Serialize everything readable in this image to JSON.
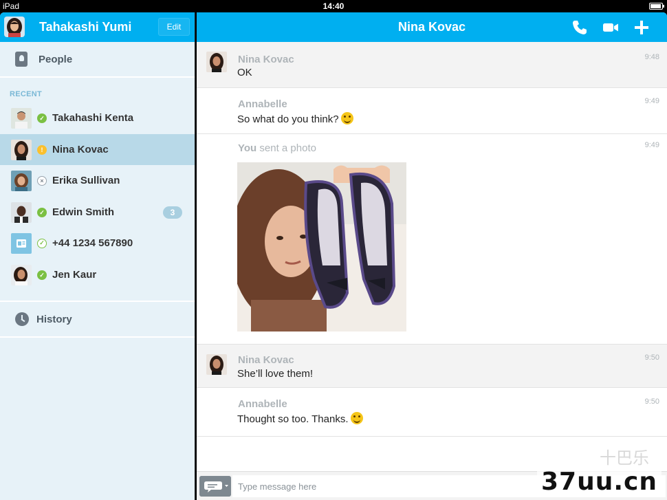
{
  "status_bar": {
    "device": "iPad",
    "time": "14:40"
  },
  "sidebar": {
    "user_name": "Tahakashi Yumi",
    "edit_label": "Edit",
    "people_label": "People",
    "recent_label": "RECENT",
    "contacts": [
      {
        "name": "Takahashi Kenta",
        "status": "online",
        "badge": ""
      },
      {
        "name": "Nina Kovac",
        "status": "away",
        "badge": "",
        "selected": true
      },
      {
        "name": "Erika Sullivan",
        "status": "offline",
        "badge": ""
      },
      {
        "name": "Edwin Smith",
        "status": "online",
        "badge": "3"
      },
      {
        "name": "+44 1234 567890",
        "status": "phone",
        "badge": ""
      },
      {
        "name": "Jen Kaur",
        "status": "online",
        "badge": ""
      }
    ],
    "history_label": "History"
  },
  "chat": {
    "title": "Nina Kovac",
    "messages": [
      {
        "sender": "Nina Kovac",
        "text": "OK",
        "time": "9:48"
      },
      {
        "sender": "Annabelle",
        "text": "So what do you think?",
        "time": "9:49"
      },
      {
        "sender": "You",
        "sender_suffix": " sent a photo",
        "text": "",
        "time": "9:49"
      },
      {
        "sender": "Nina Kovac",
        "text": "She’ll love them!",
        "time": "9:50"
      },
      {
        "sender": "Annabelle",
        "text": "Thought so too. Thanks.",
        "time": "9:50"
      }
    ],
    "input_placeholder": "Type message here"
  },
  "watermark": {
    "latin": "37uu.cn",
    "cn": "十巴乐"
  },
  "colors": {
    "accent": "#00aff0",
    "sidebar_bg": "#e7f2f8",
    "selected_bg": "#b8d9e8",
    "online": "#7bc043",
    "away": "#fbc02d"
  }
}
